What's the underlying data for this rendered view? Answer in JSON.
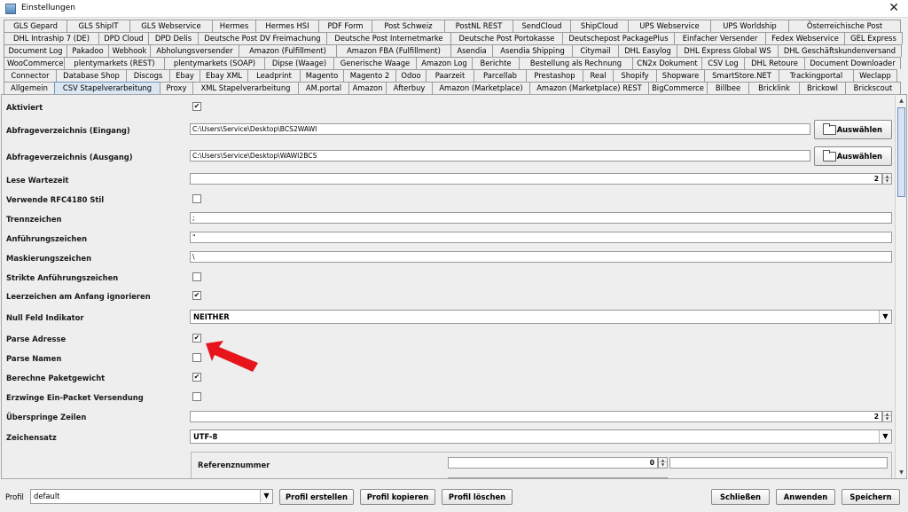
{
  "window": {
    "title": "Einstellungen",
    "close_glyph": "✕"
  },
  "tab_rows": [
    [
      "GLS Gepard",
      "GLS ShipIT",
      "GLS Webservice",
      "Hermes",
      "Hermes HSI",
      "PDF Form",
      "Post Schweiz",
      "PostNL REST",
      "SendCloud",
      "ShipCloud",
      "UPS Webservice",
      "UPS Worldship",
      "Österreichische Post"
    ],
    [
      "DHL Intraship 7 (DE)",
      "DPD Cloud",
      "DPD Delis",
      "Deutsche Post DV Freimachung",
      "Deutsche Post Internetmarke",
      "Deutsche Post Portokasse",
      "Deutschepost PackagePlus",
      "Einfacher Versender",
      "Fedex Webservice",
      "GEL Express"
    ],
    [
      "Document Log",
      "Pakadoo",
      "Webhook",
      "Abholungsversender",
      "Amazon (Fulfillment)",
      "Amazon FBA (Fulfillment)",
      "Asendia",
      "Asendia Shipping",
      "Citymail",
      "DHL Easylog",
      "DHL Express Global WS",
      "DHL Geschäftskundenversand"
    ],
    [
      "WooCommerce",
      "plentymarkets (REST)",
      "plentymarkets (SOAP)",
      "Dipse (Waage)",
      "Generische Waage",
      "Amazon Log",
      "Berichte",
      "Bestellung als Rechnung",
      "CN2x Dokument",
      "CSV Log",
      "DHL Retoure",
      "Document Downloader"
    ],
    [
      "Connector",
      "Database Shop",
      "Discogs",
      "Ebay",
      "Ebay XML",
      "Leadprint",
      "Magento",
      "Magento 2",
      "Odoo",
      "Paarzeit",
      "Parcellab",
      "Prestashop",
      "Real",
      "Shopify",
      "Shopware",
      "SmartStore.NET",
      "Trackingportal",
      "Weclapp"
    ],
    [
      "Allgemein",
      "CSV Stapelverarbeitung",
      "Proxy",
      "XML Stapelverarbeitung",
      "AM.portal",
      "Amazon",
      "Afterbuy",
      "Amazon (Marketplace)",
      "Amazon (Marketplace) REST",
      "BigCommerce",
      "Billbee",
      "Bricklink",
      "Brickowl",
      "Brickscout"
    ]
  ],
  "active_tab": "CSV Stapelverarbeitung",
  "form": {
    "aktiviert": {
      "label": "Aktiviert",
      "checked": "✔"
    },
    "abfrage_eingang": {
      "label": "Abfrageverzeichnis (Eingang)",
      "value": "C:\\Users\\Service\\Desktop\\BCS2WAWI",
      "button": "Auswählen"
    },
    "abfrage_ausgang": {
      "label": "Abfrageverzeichnis (Ausgang)",
      "value": "C:\\Users\\Service\\Desktop\\WAWI2BCS",
      "button": "Auswählen"
    },
    "lese_wartezeit": {
      "label": "Lese Wartezeit",
      "value": "2"
    },
    "rfc4180": {
      "label": "Verwende RFC4180 Stil",
      "checked": ""
    },
    "trennzeichen": {
      "label": "Trennzeichen",
      "value": ";"
    },
    "anfuehrungszeichen": {
      "label": "Anführungszeichen",
      "value": "\""
    },
    "maskierungszeichen": {
      "label": "Maskierungszeichen",
      "value": "\\"
    },
    "strikte_anfuehrungszeichen": {
      "label": "Strikte Anführungszeichen",
      "checked": ""
    },
    "leerzeichen_ignorieren": {
      "label": "Leerzeichen am Anfang ignorieren",
      "checked": "✔"
    },
    "null_feld_indikator": {
      "label": "Null Feld Indikator",
      "value": "NEITHER"
    },
    "parse_adresse": {
      "label": "Parse Adresse",
      "checked": "✔"
    },
    "parse_namen": {
      "label": "Parse Namen",
      "checked": ""
    },
    "berechne_paketgewicht": {
      "label": "Berechne Paketgewicht",
      "checked": "✔"
    },
    "erzwinge_ein_packet": {
      "label": "Erzwinge Ein-Packet Versendung",
      "checked": ""
    },
    "ueberspringe_zeilen": {
      "label": "Überspringe Zeilen",
      "value": "2"
    },
    "zeichensatz": {
      "label": "Zeichensatz",
      "value": "UTF-8"
    },
    "referenznummer": {
      "label": "Referenznummer",
      "value": "0"
    }
  },
  "bottom": {
    "profil_label": "Profil",
    "profil_value": "default",
    "profil_erstellen": "Profil erstellen",
    "profil_kopieren": "Profil kopieren",
    "profil_loeschen": "Profil löschen",
    "schliessen": "Schließen",
    "anwenden": "Anwenden",
    "speichern": "Speichern"
  },
  "colors": {
    "annotation_arrow": "#e8141b",
    "active_tab": "#dbe6f3"
  }
}
